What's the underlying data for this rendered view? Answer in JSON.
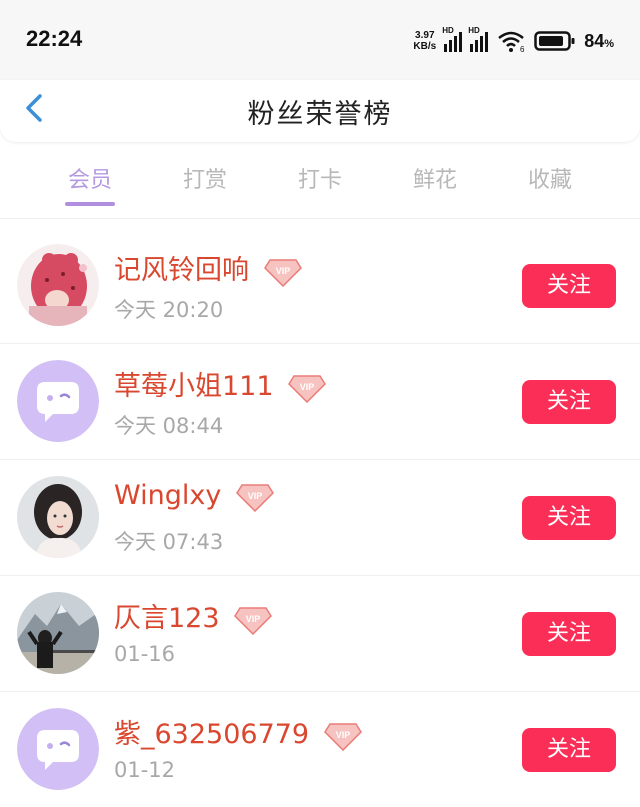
{
  "status": {
    "time": "22:24",
    "net_speed_value": "3.97",
    "net_speed_unit": "KB/s",
    "hd_1": "HD",
    "hd_2": "HD",
    "wifi_label": "6",
    "battery": "84",
    "battery_unit": "%"
  },
  "header": {
    "title": "粉丝荣誉榜",
    "back_icon": "chevron-left-icon"
  },
  "tabs": [
    {
      "label": "会员",
      "active": true
    },
    {
      "label": "打赏",
      "active": false
    },
    {
      "label": "打卡",
      "active": false
    },
    {
      "label": "鲜花",
      "active": false
    },
    {
      "label": "收藏",
      "active": false
    }
  ],
  "fans": [
    {
      "name": "记风铃回响",
      "time": "今天 20:20",
      "badge": "VIP",
      "button": "关注",
      "avatar": "pink-hoodie-avatar"
    },
    {
      "name": "草莓小姐111",
      "time": "今天 08:44",
      "badge": "VIP",
      "button": "关注",
      "avatar": "default-chat-avatar"
    },
    {
      "name": "Winglxy",
      "time": "今天 07:43",
      "badge": "VIP",
      "button": "关注",
      "avatar": "portrait-photo-avatar"
    },
    {
      "name": "仄言123",
      "time": "01-16",
      "badge": "VIP",
      "button": "关注",
      "avatar": "mountain-photo-avatar"
    },
    {
      "name": "紫_632506779",
      "time": "01-12",
      "badge": "VIP",
      "button": "关注",
      "avatar": "default-chat-avatar"
    }
  ],
  "colors": {
    "accent_tab": "#b59ae0",
    "name_red": "#d9472f",
    "follow_button": "#fa2e57",
    "back_arrow": "#3a8fd8"
  }
}
